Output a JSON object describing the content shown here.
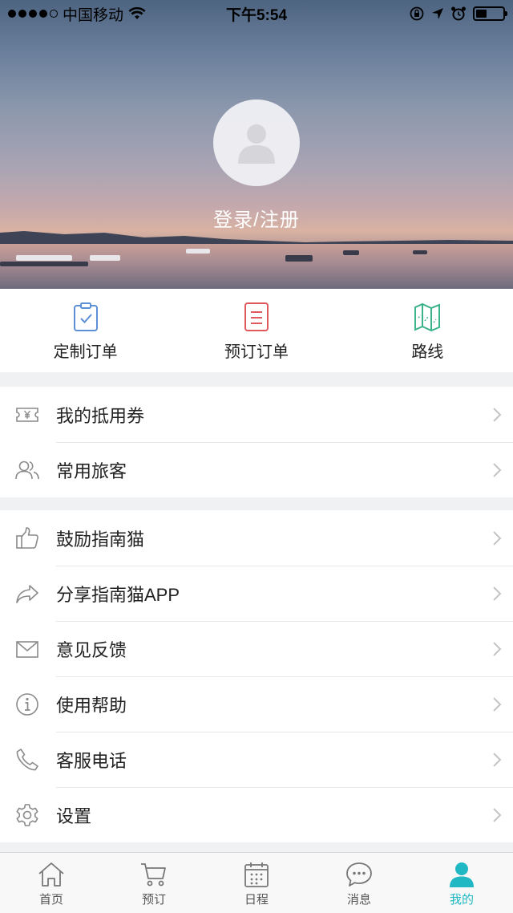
{
  "status_bar": {
    "carrier": "中国移动",
    "time": "下午5:54"
  },
  "profile": {
    "login_label": "登录/注册"
  },
  "quick_actions": [
    {
      "label": "定制订单",
      "icon": "clipboard-check-icon",
      "color": "#5b8fd6"
    },
    {
      "label": "预订订单",
      "icon": "document-list-icon",
      "color": "#e0595c"
    },
    {
      "label": "路线",
      "icon": "map-icon",
      "color": "#3bb38a"
    }
  ],
  "group1": [
    {
      "label": "我的抵用券",
      "icon": "coupon-icon"
    },
    {
      "label": "常用旅客",
      "icon": "users-icon"
    }
  ],
  "group2": [
    {
      "label": "鼓励指南猫",
      "icon": "thumbs-up-icon"
    },
    {
      "label": "分享指南猫APP",
      "icon": "share-icon"
    },
    {
      "label": "意见反馈",
      "icon": "envelope-icon"
    },
    {
      "label": "使用帮助",
      "icon": "info-icon"
    },
    {
      "label": "客服电话",
      "icon": "phone-icon"
    },
    {
      "label": "设置",
      "icon": "gear-icon"
    }
  ],
  "tabs": [
    {
      "label": "首页",
      "icon": "home-icon"
    },
    {
      "label": "预订",
      "icon": "cart-icon"
    },
    {
      "label": "日程",
      "icon": "calendar-icon"
    },
    {
      "label": "消息",
      "icon": "chat-icon"
    },
    {
      "label": "我的",
      "icon": "user-icon",
      "active": true
    }
  ],
  "colors": {
    "accent": "#1fb8c3",
    "divider": "#e6e6e6",
    "icon_gray": "#8a8a8a"
  }
}
